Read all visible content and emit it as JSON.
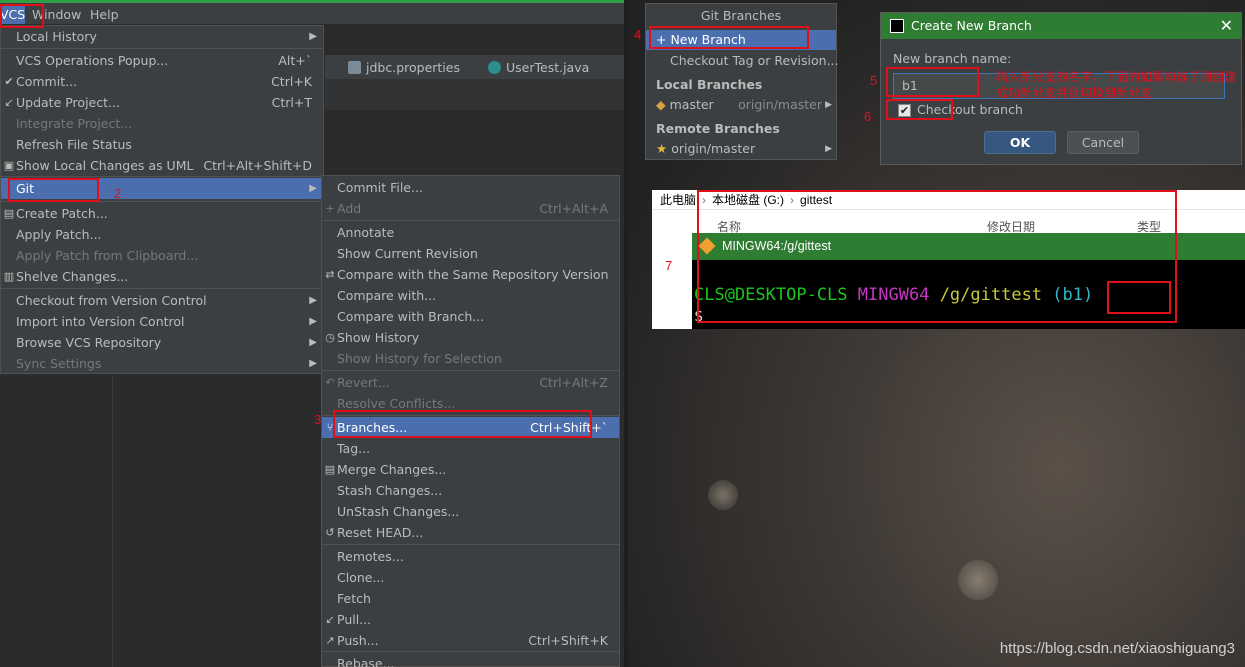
{
  "menubar": {
    "vcs": "VCS",
    "window": "Window",
    "help": "Help"
  },
  "tabs": [
    {
      "label": "jdbc.properties",
      "close": "×"
    },
    {
      "label": "UserTest.java",
      "close": "×"
    }
  ],
  "vcs_menu": {
    "items": [
      {
        "label": "Local History",
        "shortcut": "",
        "disabled": false,
        "arrow": "▶"
      },
      {
        "label": "VCS Operations Popup...",
        "shortcut": "Alt+`",
        "disabled": false
      },
      {
        "label": "Commit...",
        "shortcut": "Ctrl+K",
        "disabled": false,
        "icon": "✔"
      },
      {
        "label": "Update Project...",
        "shortcut": "Ctrl+T",
        "disabled": false,
        "icon": "↙"
      },
      {
        "label": "Integrate Project...",
        "shortcut": "",
        "disabled": true
      },
      {
        "label": "Refresh File Status",
        "shortcut": "",
        "disabled": false
      },
      {
        "label": "Show Local Changes as UML",
        "shortcut": "Ctrl+Alt+Shift+D",
        "disabled": false,
        "icon": "▣"
      },
      {
        "label": "Git",
        "shortcut": "",
        "disabled": false,
        "arrow": "▶"
      },
      {
        "label": "Create Patch...",
        "shortcut": "",
        "disabled": false,
        "icon": "▤"
      },
      {
        "label": "Apply Patch...",
        "shortcut": "",
        "disabled": false
      },
      {
        "label": "Apply Patch from Clipboard...",
        "shortcut": "",
        "disabled": true
      },
      {
        "label": "Shelve Changes...",
        "shortcut": "",
        "disabled": false,
        "icon": "▥"
      },
      {
        "label": "Checkout from Version Control",
        "shortcut": "",
        "disabled": false,
        "arrow": "▶"
      },
      {
        "label": "Import into Version Control",
        "shortcut": "",
        "disabled": false,
        "arrow": "▶"
      },
      {
        "label": "Browse VCS Repository",
        "shortcut": "",
        "disabled": false,
        "arrow": "▶"
      },
      {
        "label": "Sync Settings",
        "shortcut": "",
        "disabled": true,
        "arrow": "▶"
      }
    ]
  },
  "git_menu": {
    "items": [
      {
        "label": "Commit File...",
        "shortcut": "",
        "disabled": false
      },
      {
        "label": "Add",
        "shortcut": "Ctrl+Alt+A",
        "disabled": true,
        "icon": "+"
      },
      {
        "label": "Annotate",
        "shortcut": "",
        "disabled": false
      },
      {
        "label": "Show Current Revision",
        "shortcut": "",
        "disabled": false
      },
      {
        "label": "Compare with the Same Repository Version",
        "shortcut": "",
        "disabled": false,
        "icon": "⇄"
      },
      {
        "label": "Compare with...",
        "shortcut": "",
        "disabled": false
      },
      {
        "label": "Compare with Branch...",
        "shortcut": "",
        "disabled": false
      },
      {
        "label": "Show History",
        "shortcut": "",
        "disabled": false,
        "icon": "◷"
      },
      {
        "label": "Show History for Selection",
        "shortcut": "",
        "disabled": true
      },
      {
        "label": "Revert...",
        "shortcut": "Ctrl+Alt+Z",
        "disabled": true,
        "icon": "↶"
      },
      {
        "label": "Resolve Conflicts...",
        "shortcut": "",
        "disabled": true
      },
      {
        "label": "Branches...",
        "shortcut": "Ctrl+Shift+`",
        "disabled": false,
        "icon": "⑂"
      },
      {
        "label": "Tag...",
        "shortcut": "",
        "disabled": false
      },
      {
        "label": "Merge Changes...",
        "shortcut": "",
        "disabled": false,
        "icon": "▤"
      },
      {
        "label": "Stash Changes...",
        "shortcut": "",
        "disabled": false
      },
      {
        "label": "UnStash Changes...",
        "shortcut": "",
        "disabled": false
      },
      {
        "label": "Reset HEAD...",
        "shortcut": "",
        "disabled": false,
        "icon": "↺"
      },
      {
        "label": "Remotes...",
        "shortcut": "",
        "disabled": false
      },
      {
        "label": "Clone...",
        "shortcut": "",
        "disabled": false
      },
      {
        "label": "Fetch",
        "shortcut": "",
        "disabled": false
      },
      {
        "label": "Pull...",
        "shortcut": "",
        "disabled": false,
        "icon": "↙"
      },
      {
        "label": "Push...",
        "shortcut": "Ctrl+Shift+K",
        "disabled": false,
        "icon": "↗"
      },
      {
        "label": "Rebase...",
        "shortcut": "",
        "disabled": false
      }
    ]
  },
  "git_branches": {
    "title": "Git Branches",
    "new_branch": "+ New Branch",
    "checkout_tag": "Checkout Tag or Revision...",
    "local_header": "Local Branches",
    "local": [
      {
        "name": "master",
        "tracking": "origin/master"
      }
    ],
    "remote_header": "Remote Branches",
    "remote": [
      {
        "name": "origin/master"
      }
    ]
  },
  "dialog": {
    "title": "Create New Branch",
    "close": "✕",
    "label": "New branch name:",
    "value": "b1",
    "checkbox_label": "Checkout branch",
    "checked": "✔",
    "ok": "OK",
    "cancel": "Cancel",
    "annotation": "输入新分支的名字，下面的如果勾选了则创建成功新分支并且切换到新分支"
  },
  "explorer": {
    "crumbs": [
      "此电脑",
      "本地磁盘 (G:)",
      "gittest"
    ],
    "col_name": "名称",
    "col_date": "修改日期",
    "col_type": "类型"
  },
  "terminal": {
    "title": "MINGW64:/g/gittest",
    "user": "CLS@DESKTOP-CLS",
    "env": "MINGW64",
    "path": "/g/gittest",
    "branch": "(b1)",
    "prompt": "$"
  },
  "annotations": {
    "n2": "2",
    "n3": "3",
    "n4": "4",
    "n5": "5",
    "n6": "6",
    "n7": "7"
  },
  "watermark": "https://blog.csdn.net/xiaoshiguang3",
  "colors": {
    "accent": "#4b6eaf",
    "annotation_red": "#e0101a",
    "title_green": "#2e7d32"
  }
}
